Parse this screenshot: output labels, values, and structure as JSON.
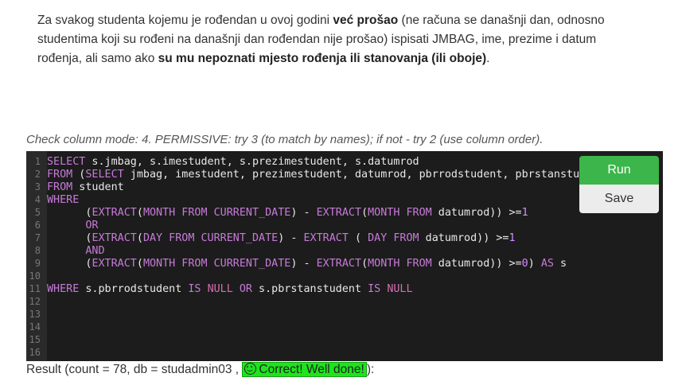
{
  "task": {
    "part1": "Za svakog studenta kojemu je rođendan u ovoj godini ",
    "bold1": "već prošao",
    "part2": " (ne računa se današnji dan, odnosno studentima koji su rođeni na današnji dan rođendan nije prošao) ispisati JMBAG, ime, prezime i datum rođenja, ali samo ako ",
    "bold2": "su mu nepoznati mjesto rođenja ili stanovanja (ili oboje)",
    "part3": "."
  },
  "check_mode": "Check column mode: 4. PERMISSIVE: try 3 (to match by names); if not - try 2 (use column order).",
  "editor": {
    "line_numbers": [
      "1",
      "2",
      "3",
      "4",
      "5",
      "6",
      "7",
      "8",
      "9",
      "10",
      "11",
      "12",
      "13",
      "14",
      "15",
      "16"
    ],
    "lines": [
      [
        [
          "kw",
          "SELECT"
        ],
        [
          "plain",
          " s.jmbag, s.imestudent, s.prezimestudent, s.datumrod"
        ]
      ],
      [
        [
          "kw",
          "FROM"
        ],
        [
          "plain",
          " ("
        ],
        [
          "kw",
          "SELECT"
        ],
        [
          "plain",
          " jmbag, imestudent, prezimestudent, datumrod, pbrrodstudent, pbrstanstudent,"
        ]
      ],
      [
        [
          "kw",
          "FROM"
        ],
        [
          "plain",
          " student"
        ]
      ],
      [
        [
          "kw",
          "WHERE"
        ]
      ],
      [
        [
          "plain",
          "      ("
        ],
        [
          "fn",
          "EXTRACT"
        ],
        [
          "plain",
          "("
        ],
        [
          "kw",
          "MONTH FROM CURRENT_DATE"
        ],
        [
          "plain",
          ") - "
        ],
        [
          "fn",
          "EXTRACT"
        ],
        [
          "plain",
          "("
        ],
        [
          "kw",
          "MONTH FROM"
        ],
        [
          "plain",
          " datumrod)) >="
        ],
        [
          "num",
          "1"
        ]
      ],
      [
        [
          "plain",
          "      "
        ],
        [
          "kw",
          "OR"
        ]
      ],
      [
        [
          "plain",
          "      ("
        ],
        [
          "fn",
          "EXTRACT"
        ],
        [
          "plain",
          "("
        ],
        [
          "kw",
          "DAY FROM CURRENT_DATE"
        ],
        [
          "plain",
          ") - "
        ],
        [
          "fn",
          "EXTRACT"
        ],
        [
          "plain",
          " ( "
        ],
        [
          "kw",
          "DAY FROM"
        ],
        [
          "plain",
          " datumrod)) >="
        ],
        [
          "num",
          "1"
        ]
      ],
      [
        [
          "plain",
          "      "
        ],
        [
          "kw",
          "AND"
        ]
      ],
      [
        [
          "plain",
          "      ("
        ],
        [
          "fn",
          "EXTRACT"
        ],
        [
          "plain",
          "("
        ],
        [
          "kw",
          "MONTH FROM CURRENT_DATE"
        ],
        [
          "plain",
          ") - "
        ],
        [
          "fn",
          "EXTRACT"
        ],
        [
          "plain",
          "("
        ],
        [
          "kw",
          "MONTH FROM"
        ],
        [
          "plain",
          " datumrod)) >="
        ],
        [
          "num",
          "0"
        ],
        [
          "plain",
          ") "
        ],
        [
          "kw",
          "AS"
        ],
        [
          "plain",
          " s"
        ]
      ],
      [],
      [
        [
          "kw",
          "WHERE"
        ],
        [
          "plain",
          " s.pbrrodstudent "
        ],
        [
          "kw",
          "IS"
        ],
        [
          "plain",
          " "
        ],
        [
          "null",
          "NULL"
        ],
        [
          "plain",
          " "
        ],
        [
          "kw",
          "OR"
        ],
        [
          "plain",
          " s.pbrstanstudent "
        ],
        [
          "kw",
          "IS"
        ],
        [
          "plain",
          " "
        ],
        [
          "null",
          "NULL"
        ]
      ],
      [],
      [],
      [],
      [],
      []
    ]
  },
  "buttons": {
    "run": "Run",
    "save": "Save"
  },
  "result": {
    "prefix": "Result (count = 78, db = studadmin03 , ",
    "correct": "Correct! Well done!",
    "suffix": "):"
  },
  "colors": {
    "run_button": "#3cb54a",
    "correct_badge": "#1de41d",
    "editor_bg": "#1c1c1c"
  }
}
